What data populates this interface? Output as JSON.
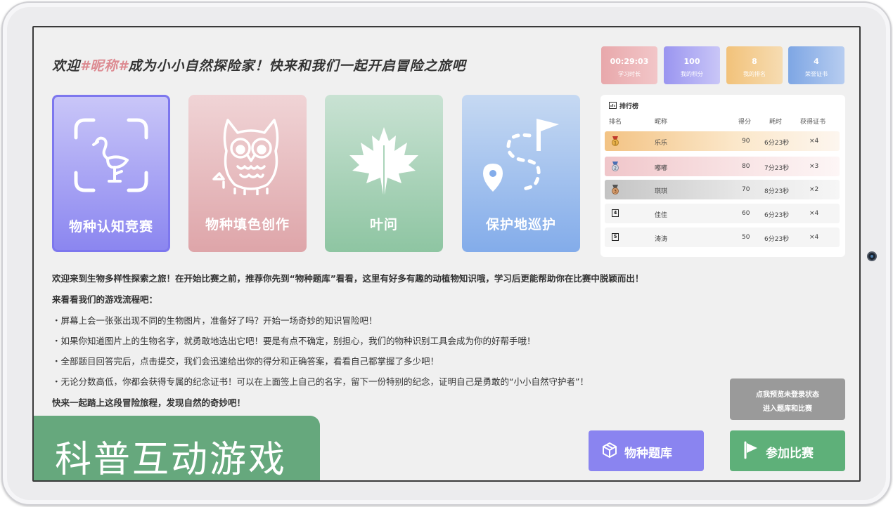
{
  "welcome": {
    "prefix": "欢迎",
    "nickname": "#昵称#",
    "suffix": "成为小小自然探险家！快来和我们一起开启冒险之旅吧"
  },
  "stats": [
    {
      "value": "00:29:03",
      "label": "学习时长",
      "color": "#e8a8ab"
    },
    {
      "value": "100",
      "label": "我的积分",
      "color": "#9a95f0"
    },
    {
      "value": "8",
      "label": "我的排名",
      "color": "#f2c27a"
    },
    {
      "value": "4",
      "label": "荣誉证书",
      "color": "#7ea6e4"
    }
  ],
  "cards": [
    {
      "title": "物种认知竞赛",
      "icon": "flamingo-scan-icon",
      "color": "#8b86f0"
    },
    {
      "title": "物种填色创作",
      "icon": "owl-icon",
      "color": "#dea5a9"
    },
    {
      "title": "叶问",
      "icon": "maple-leaf-icon",
      "color": "#8ec5a2"
    },
    {
      "title": "保护地巡护",
      "icon": "route-flag-icon",
      "color": "#83acea"
    }
  ],
  "leaderboard": {
    "title": "排行榜",
    "headers": {
      "rank": "排名",
      "nickname": "昵称",
      "score": "得分",
      "time": "耗时",
      "certs": "获得证书"
    },
    "rows": [
      {
        "rank": "1",
        "name": "乐乐",
        "score": "90",
        "time": "6分23秒",
        "certs": "×4"
      },
      {
        "rank": "2",
        "name": "嘟嘟",
        "score": "80",
        "time": "7分23秒",
        "certs": "×3"
      },
      {
        "rank": "3",
        "name": "琪琪",
        "score": "70",
        "time": "8分23秒",
        "certs": "×2"
      },
      {
        "rank": "4",
        "name": "佳佳",
        "score": "60",
        "time": "6分23秒",
        "certs": "×4"
      },
      {
        "rank": "5",
        "name": "涛涛",
        "score": "50",
        "time": "6分23秒",
        "certs": "×4"
      }
    ]
  },
  "intro": {
    "p1": "欢迎来到生物多样性探索之旅！在开始比赛之前，推荐你先到“物种题库”看看，这里有好多有趣的动植物知识哦，学习后更能帮助你在比赛中脱颖而出！",
    "p2": "来看看我们的游戏流程吧：",
    "steps": [
      "・屏幕上会一张张出现不同的生物图片，准备好了吗？开始一场奇妙的知识冒险吧！",
      "・如果你知道图片上的生物名字，就勇敢地选出它吧！要是有点不确定，别担心，我们的物种识别工具会成为你的好帮手哦！",
      "・全部题目回答完后，点击提交，我们会迅速给出你的得分和正确答案，看看自己都掌握了多少吧！",
      "・无论分数高低，你都会获得专属的纪念证书！可以在上面签上自己的名字，留下一份特别的纪念，证明自己是勇敢的“小小自然守护者”！"
    ],
    "p3": "快来一起踏上这段冒险旅程，发现自然的奇妙吧！"
  },
  "buttons": {
    "preview_line1": "点我预览未登录状态",
    "preview_line2": "进入题库和比赛",
    "bank": "物种题库",
    "join": "参加比赛"
  },
  "banner": "科普互动游戏"
}
